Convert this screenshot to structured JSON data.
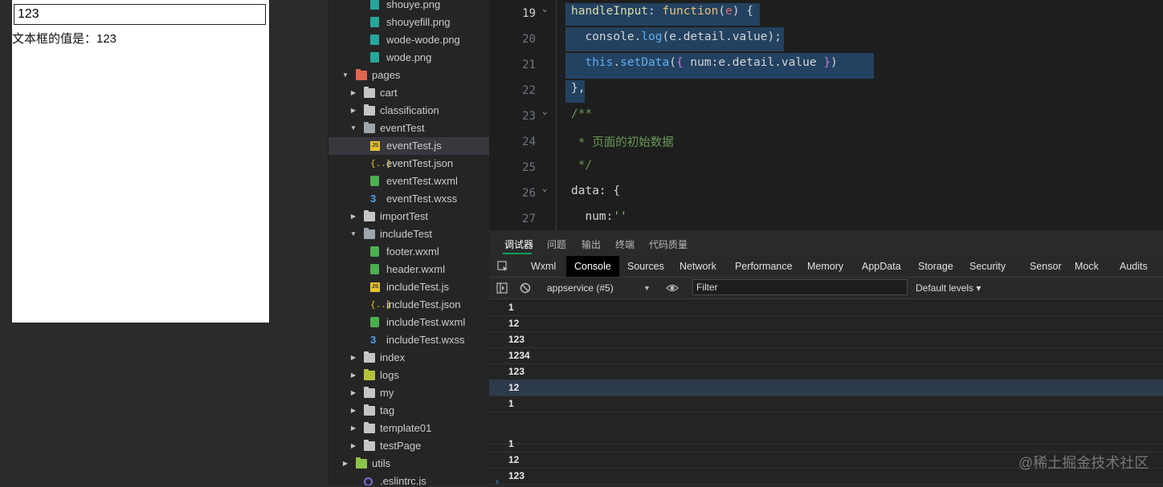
{
  "simulator": {
    "input_value": "123",
    "display_text": "文本框的值是：123"
  },
  "file_tree": [
    {
      "label": "shouye.png",
      "icon": "png-file-icon",
      "depth": 3,
      "arrow": ""
    },
    {
      "label": "shouyefill.png",
      "icon": "png-file-icon",
      "depth": 3,
      "arrow": ""
    },
    {
      "label": "wode-wode.png",
      "icon": "png-file-icon",
      "depth": 3,
      "arrow": ""
    },
    {
      "label": "wode.png",
      "icon": "png-file-icon",
      "depth": 3,
      "arrow": ""
    },
    {
      "label": "pages",
      "icon": "folder-open-icon",
      "depth": 1,
      "arrow": "▼"
    },
    {
      "label": "cart",
      "icon": "folder-icon",
      "depth": 2,
      "arrow": "▶"
    },
    {
      "label": "classification",
      "icon": "folder-icon",
      "depth": 2,
      "arrow": "▶"
    },
    {
      "label": "eventTest",
      "icon": "folder-open-icon",
      "depth": 2,
      "arrow": "▼"
    },
    {
      "label": "eventTest.js",
      "icon": "js-file-icon",
      "depth": 3,
      "arrow": "",
      "selected": true
    },
    {
      "label": "eventTest.json",
      "icon": "json-file-icon",
      "depth": 3,
      "arrow": ""
    },
    {
      "label": "eventTest.wxml",
      "icon": "wxml-file-icon",
      "depth": 3,
      "arrow": ""
    },
    {
      "label": "eventTest.wxss",
      "icon": "wxss-file-icon",
      "depth": 3,
      "arrow": ""
    },
    {
      "label": "importTest",
      "icon": "folder-icon",
      "depth": 2,
      "arrow": "▶"
    },
    {
      "label": "includeTest",
      "icon": "folder-open-icon",
      "depth": 2,
      "arrow": "▼"
    },
    {
      "label": "footer.wxml",
      "icon": "wxml-file-icon",
      "depth": 3,
      "arrow": ""
    },
    {
      "label": "header.wxml",
      "icon": "wxml-file-icon",
      "depth": 3,
      "arrow": ""
    },
    {
      "label": "includeTest.js",
      "icon": "js-file-icon",
      "depth": 3,
      "arrow": ""
    },
    {
      "label": "includeTest.json",
      "icon": "json-file-icon",
      "depth": 3,
      "arrow": ""
    },
    {
      "label": "includeTest.wxml",
      "icon": "wxml-file-icon",
      "depth": 3,
      "arrow": ""
    },
    {
      "label": "includeTest.wxss",
      "icon": "wxss-file-icon",
      "depth": 3,
      "arrow": ""
    },
    {
      "label": "index",
      "icon": "folder-icon",
      "depth": 2,
      "arrow": "▶"
    },
    {
      "label": "logs",
      "icon": "folder-icon",
      "depth": 2,
      "arrow": "▶"
    },
    {
      "label": "my",
      "icon": "folder-icon",
      "depth": 2,
      "arrow": "▶"
    },
    {
      "label": "tag",
      "icon": "folder-icon",
      "depth": 2,
      "arrow": "▶"
    },
    {
      "label": "template01",
      "icon": "folder-icon",
      "depth": 2,
      "arrow": "▶"
    },
    {
      "label": "testPage",
      "icon": "folder-icon",
      "depth": 2,
      "arrow": "▶"
    },
    {
      "label": "utils",
      "icon": "folder-icon",
      "depth": 1,
      "arrow": "▶"
    },
    {
      "label": ".eslintrc.js",
      "icon": "config-file-icon",
      "depth": 2,
      "arrow": ""
    }
  ],
  "editor": {
    "lines": [
      {
        "num": "19",
        "fold": "⌄"
      },
      {
        "num": "20",
        "fold": ""
      },
      {
        "num": "21",
        "fold": ""
      },
      {
        "num": "22",
        "fold": ""
      },
      {
        "num": "23",
        "fold": "⌄"
      },
      {
        "num": "24",
        "fold": ""
      },
      {
        "num": "25",
        "fold": ""
      },
      {
        "num": "26",
        "fold": "⌄"
      },
      {
        "num": "27",
        "fold": ""
      }
    ],
    "code": [
      "handleInput: function(e) {",
      "  console.log(e.detail.value);",
      "  this.setData({ num:e.detail.value })",
      "},",
      "/**",
      " * 页面的初始数据",
      " */",
      "data: {",
      "  num:''"
    ]
  },
  "debug": {
    "top_tabs": [
      "调试器",
      "问题",
      "输出",
      "终端",
      "代码质量"
    ],
    "panel_tabs": [
      "Wxml",
      "Console",
      "Sources",
      "Network",
      "Performance",
      "Memory",
      "AppData",
      "Storage",
      "Security",
      "Sensor",
      "Mock",
      "Audits"
    ],
    "context_select": "appservice (#5)",
    "filter_placeholder": "Filter",
    "levels_label": "Default levels ▾",
    "console_lines": [
      "1",
      "12",
      "123",
      "1234",
      "123",
      "12",
      "1",
      "",
      "1",
      "12",
      "123"
    ],
    "prompt": "›"
  },
  "watermark": "@稀土掘金技术社区"
}
